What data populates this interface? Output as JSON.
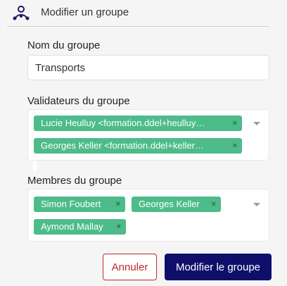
{
  "header": {
    "title": "Modifier un groupe",
    "icon": "group-icon"
  },
  "group_name": {
    "label": "Nom du groupe",
    "value": "Transports"
  },
  "validators": {
    "label": "Validateurs du groupe",
    "tags": [
      "Lucie Heulluy <formation.ddel+heulluy…",
      "Georges Keller <formation.ddel+keller…"
    ]
  },
  "members": {
    "label": "Membres du groupe",
    "tags": [
      "Simon Foubert",
      "Georges Keller",
      "Aymond Mallay"
    ]
  },
  "remove_glyph": "×",
  "buttons": {
    "cancel": "Annuler",
    "submit": "Modifier le groupe"
  },
  "colors": {
    "tag": "#4dbb8a",
    "primary": "#0f0f6b",
    "danger": "#c1272d"
  }
}
